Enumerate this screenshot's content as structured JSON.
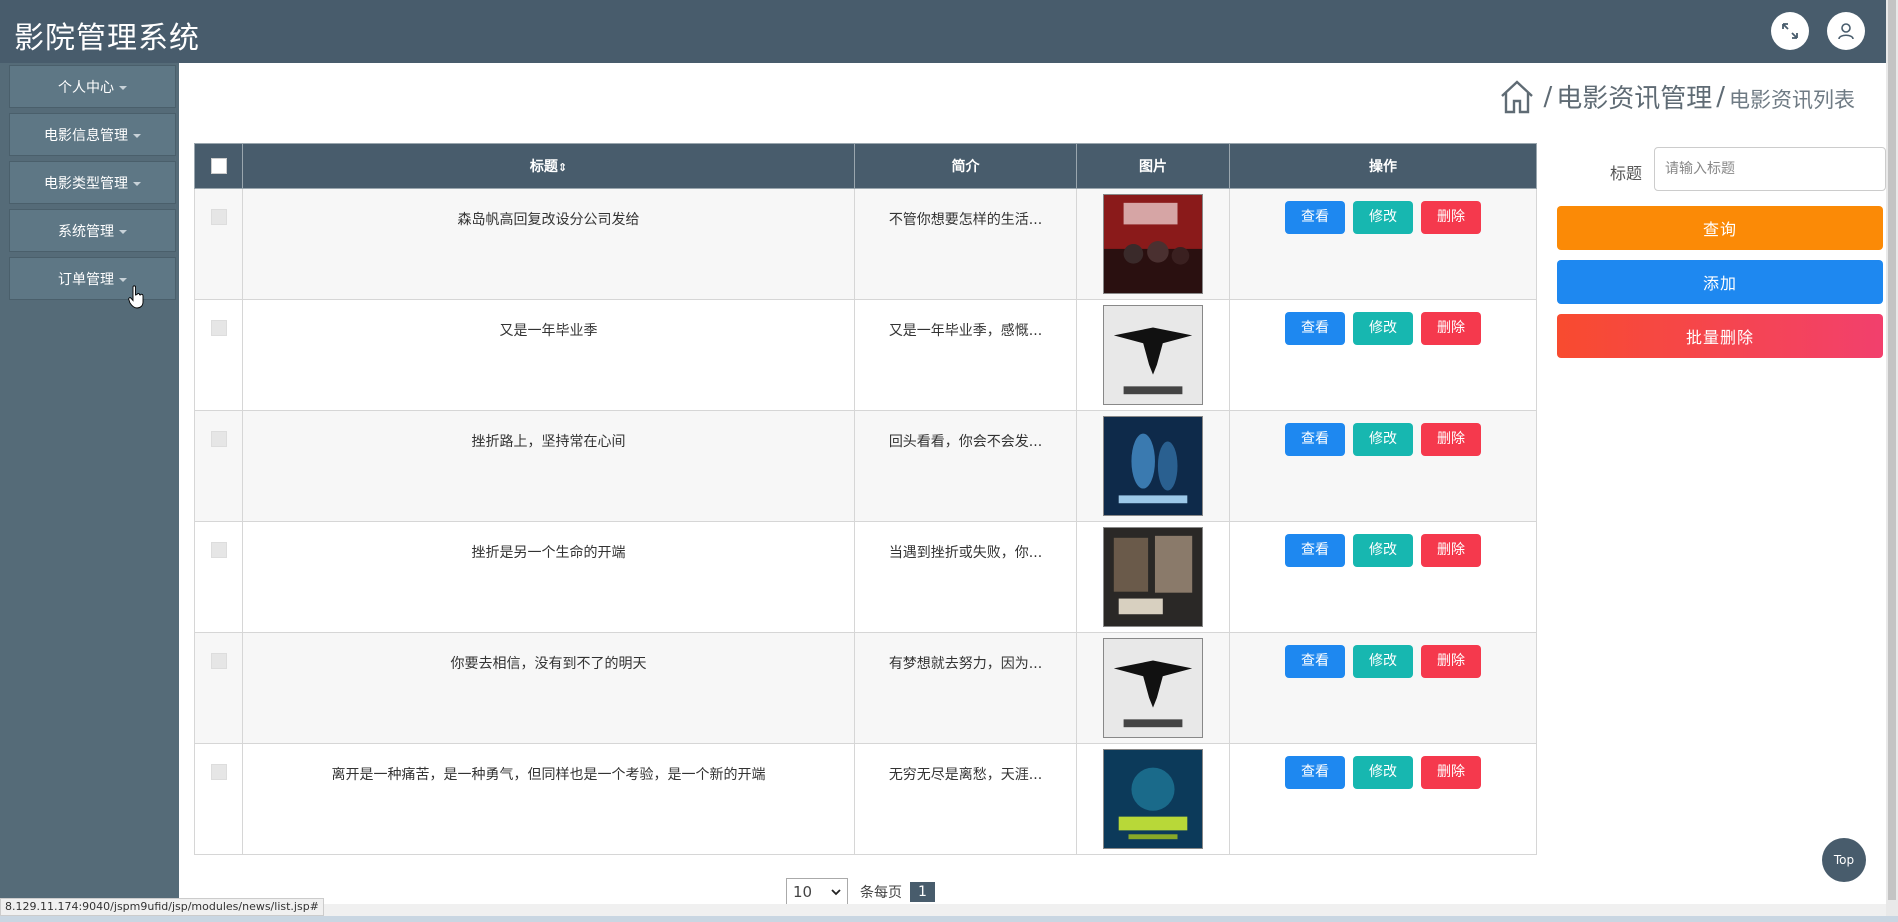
{
  "header": {
    "title": "影院管理系统",
    "fullscreen_icon": "expand-icon",
    "user_icon": "user-icon"
  },
  "sidebar": {
    "items": [
      {
        "label": "个人中心"
      },
      {
        "label": "电影信息管理"
      },
      {
        "label": "电影类型管理"
      },
      {
        "label": "系统管理"
      },
      {
        "label": "订单管理"
      }
    ]
  },
  "breadcrumb": {
    "level1": "电影资讯管理",
    "level2": "电影资讯列表",
    "separator": "/"
  },
  "table": {
    "headers": {
      "title": "标题",
      "sort_glyph": "⇕",
      "summary": "简介",
      "image": "图片",
      "actions": "操作"
    },
    "rows": [
      {
        "title": "森岛帆高回复改设分公司发给",
        "summary": "不管你想要怎样的生活..."
      },
      {
        "title": "又是一年毕业季",
        "summary": "又是一年毕业季，感慨..."
      },
      {
        "title": "挫折路上，坚持常在心间",
        "summary": "回头看看，你会不会发..."
      },
      {
        "title": "挫折是另一个生命的开端",
        "summary": "当遇到挫折或失败，你..."
      },
      {
        "title": "你要去相信，没有到不了的明天",
        "summary": "有梦想就去努力，因为..."
      },
      {
        "title": "离开是一种痛苦，是一种勇气，但同样也是一个考验，是一个新的开端",
        "summary": "无穷无尽是离愁，天涯..."
      }
    ],
    "row_actions": {
      "view": "查看",
      "edit": "修改",
      "delete": "删除"
    }
  },
  "pagination": {
    "page_size": "10",
    "per_page_label": "条每页",
    "current_page": "1"
  },
  "search": {
    "label": "标题",
    "placeholder": "请输入标题"
  },
  "buttons": {
    "query": "查询",
    "add": "添加",
    "batch_delete": "批量删除"
  },
  "top_button": "Top",
  "status_url": "8.129.11.174:9040/jspm9ufid/jsp/modules/news/list.jsp#",
  "colors": {
    "header_bg": "#485c6c",
    "sidebar_bg": "#556b78",
    "query": "#fb8a06",
    "add": "#1e88f0",
    "view": "#1e88f0",
    "edit": "#17b7b0",
    "delete": "#f5394d"
  }
}
